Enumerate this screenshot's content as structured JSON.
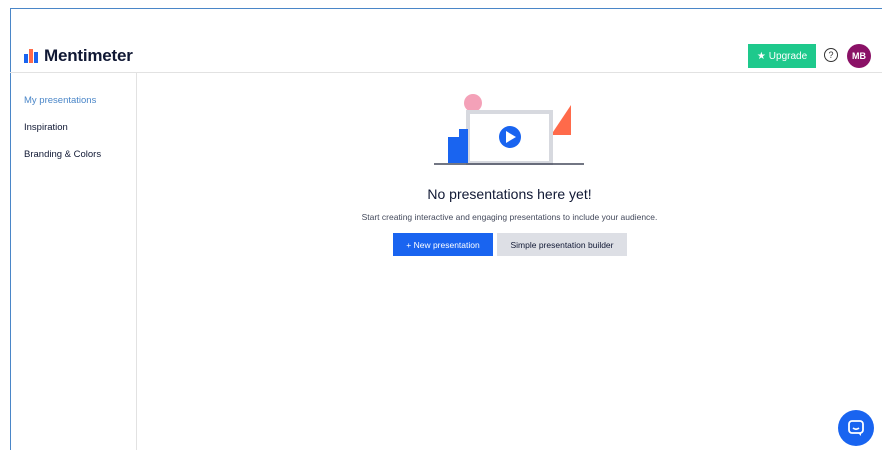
{
  "brand": {
    "name": "Mentimeter",
    "logo_icon": "mentimeter-logo-icon"
  },
  "header": {
    "upgrade_label": "Upgrade",
    "upgrade_icon": "star-icon",
    "help_icon": "question-circle-icon",
    "avatar_initials": "MB"
  },
  "sidebar": {
    "items": [
      {
        "label": "My presentations",
        "active": true
      },
      {
        "label": "Inspiration",
        "active": false
      },
      {
        "label": "Branding & Colors",
        "active": false
      }
    ]
  },
  "main": {
    "empty_title": "No presentations here yet!",
    "empty_subtitle": "Start creating interactive and engaging presentations to include your audience.",
    "new_button_label": "+ New presentation",
    "builder_button_label": "Simple presentation builder"
  },
  "colors": {
    "accent_blue": "#1964f0",
    "upgrade_green": "#1ec98c",
    "avatar_purple": "#8a1166",
    "active_nav": "#4a86c8",
    "illus_pink": "#f4a1b8",
    "illus_orange": "#ff6a4a"
  },
  "chat_icon": "chat-bubble-icon"
}
